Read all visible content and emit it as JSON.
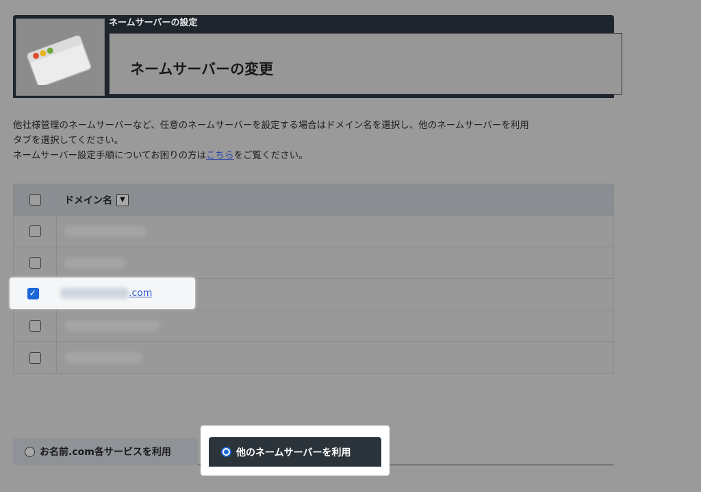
{
  "header": {
    "section_title": "ネームサーバーの設定",
    "page_title": "ネームサーバーの変更"
  },
  "description": {
    "line1": "他社様管理のネームサーバーなど、任意のネームサーバーを設定する場合はドメイン名を選択し、他のネームサーバーを利用",
    "line2": "タブを選択してください。",
    "line3_before": "ネームサーバー設定手順についてお困りの方は",
    "line3_link": "こちら",
    "line3_after": "をご覧ください。"
  },
  "table": {
    "header_label": "ドメイン名",
    "sort_icon": "▼",
    "selected_suffix": ".com",
    "rows": [
      {
        "checked": false
      },
      {
        "checked": false
      },
      {
        "checked": true
      },
      {
        "checked": false
      },
      {
        "checked": false
      }
    ]
  },
  "tabs": {
    "left_label": "お名前.com各サービスを利用",
    "right_label": "他のネームサーバーを利用",
    "selected": "right"
  },
  "colors": {
    "accent": "#1a66d6",
    "panel_dark": "#1e252c",
    "link": "#2857c8"
  },
  "icons": {
    "checkmark": "✓"
  }
}
